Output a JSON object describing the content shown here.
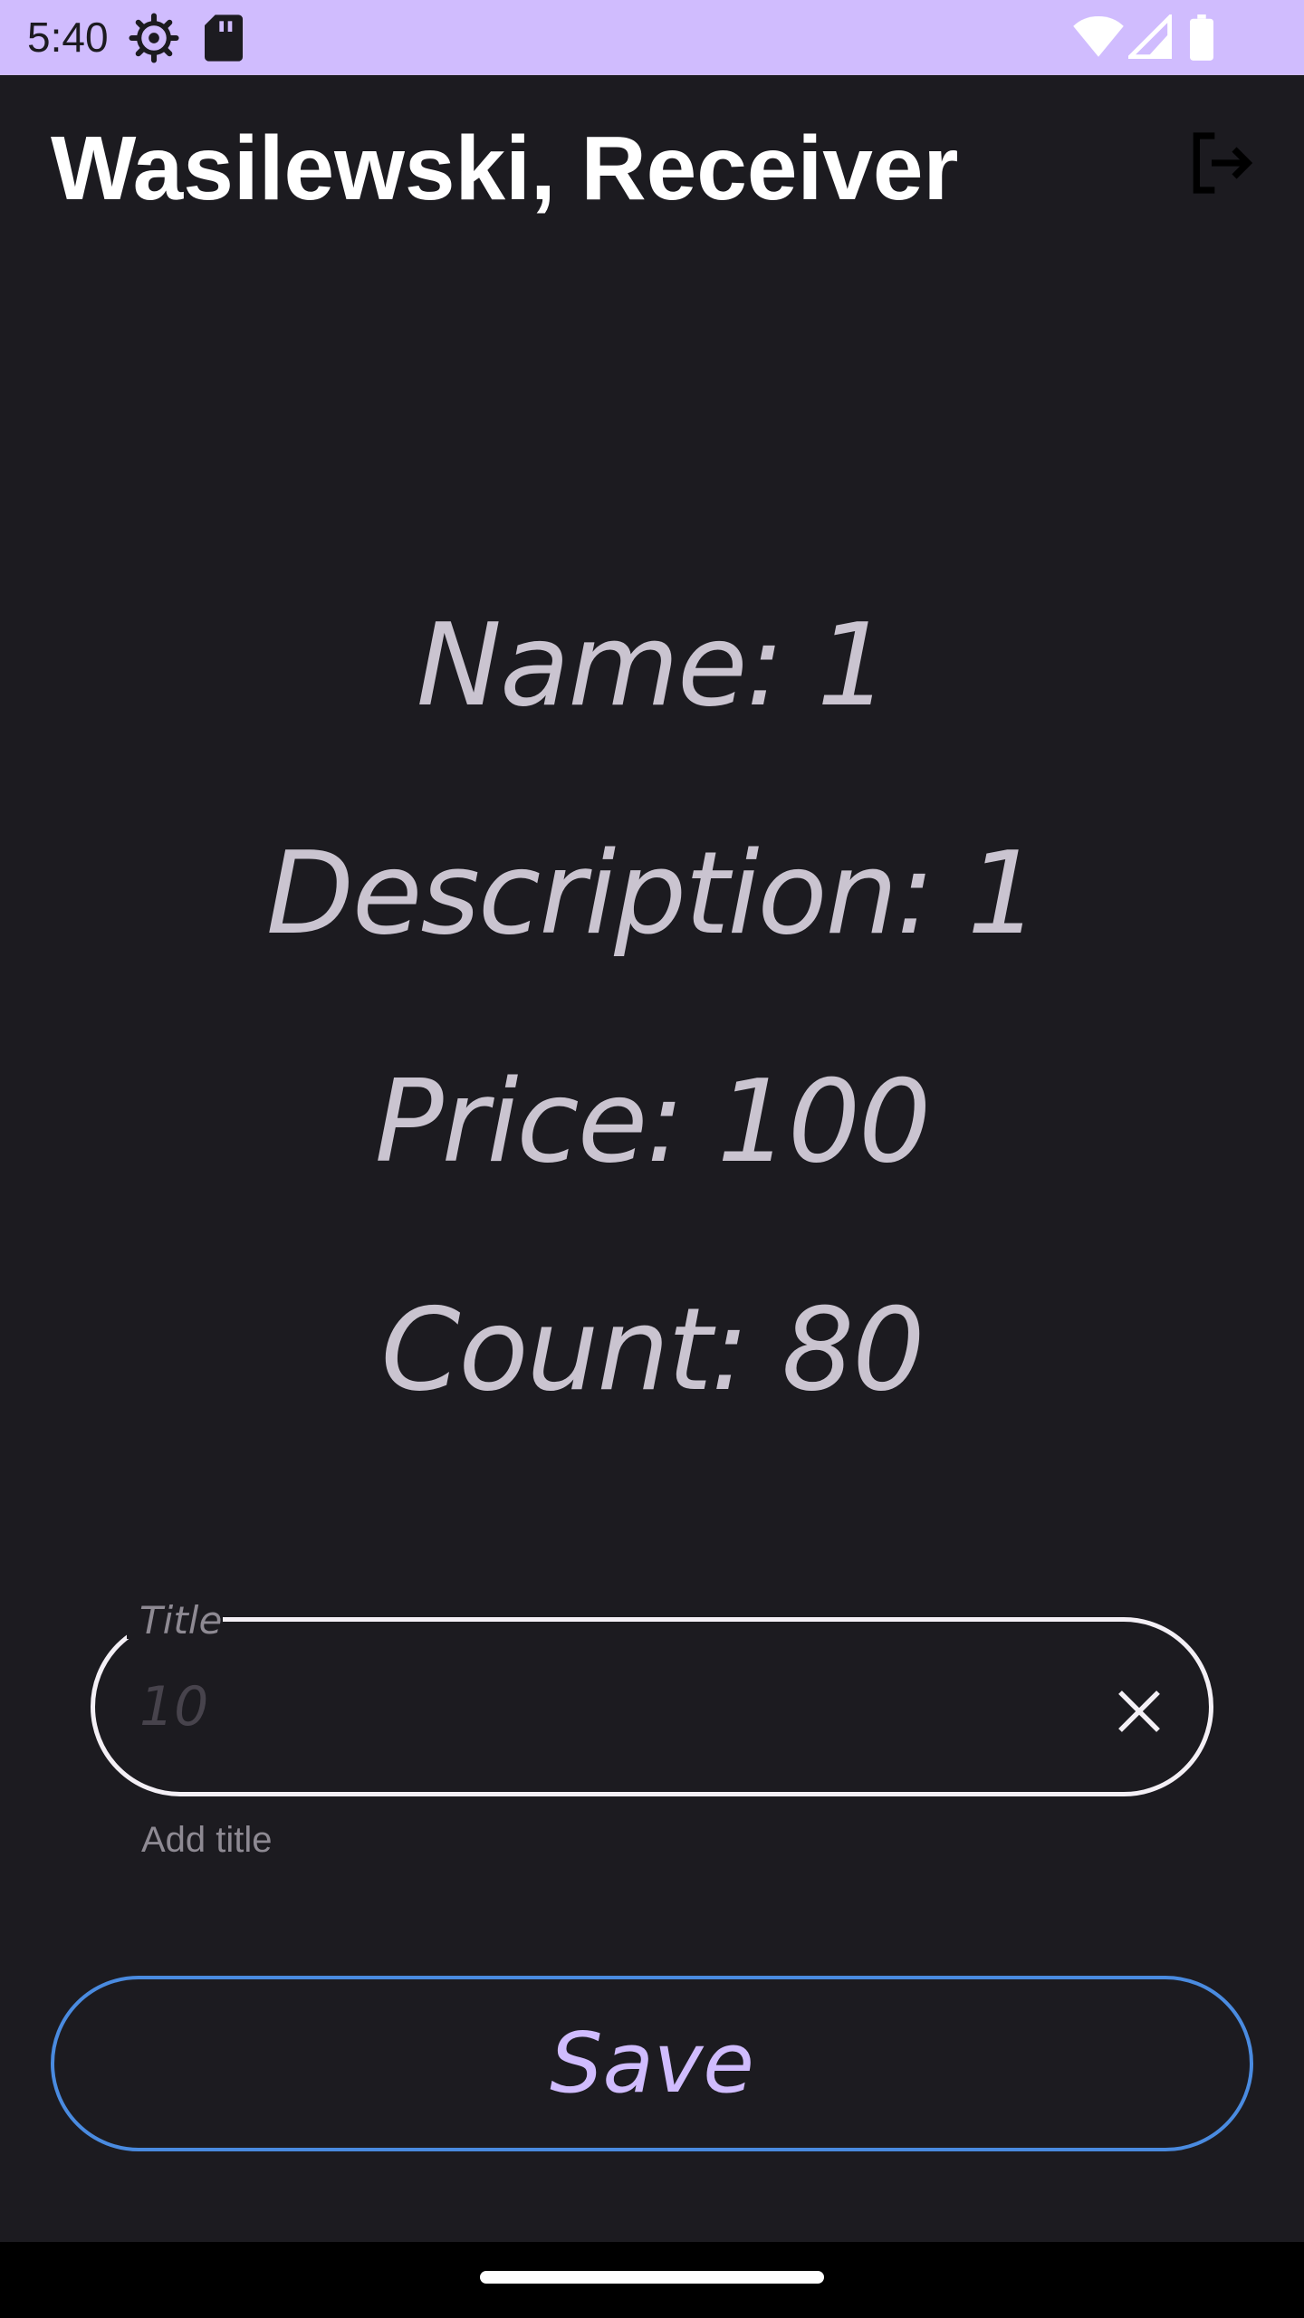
{
  "status_bar": {
    "time": "5:40",
    "icons": [
      "settings-gear-icon",
      "sd-card-icon",
      "wifi-icon",
      "signal-icon",
      "battery-icon"
    ],
    "background": "#d0bcfe"
  },
  "app_bar": {
    "title": "Wasilewski, Receiver",
    "action_icon": "logout-icon"
  },
  "details": {
    "name": "Name: 1",
    "description": "Description: 1",
    "price": "Price: 100",
    "count": "Count: 80"
  },
  "title_field": {
    "label": "Title",
    "value": "10",
    "helper": "Add title",
    "trailing_icon": "close-icon"
  },
  "save_button": {
    "label": "Save"
  },
  "colors": {
    "background": "#1c1b20",
    "text": "#cac4d0",
    "accent": "#d0bcfe",
    "button_outline": "#4a8be0"
  }
}
